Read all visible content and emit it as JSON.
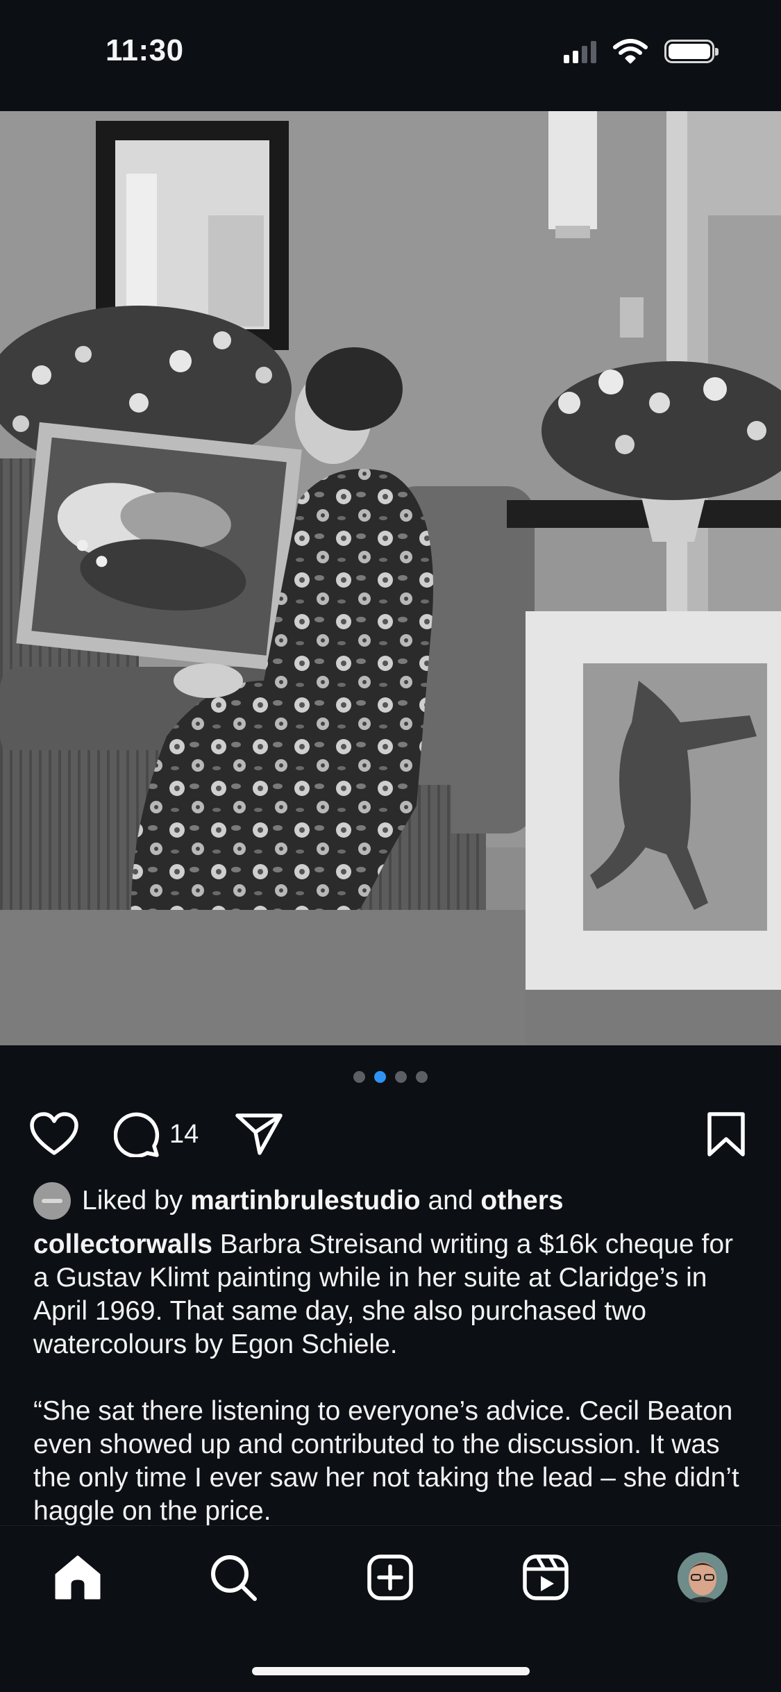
{
  "status_bar": {
    "time": "11:30",
    "signal_icon": "cellular-signal-icon",
    "wifi_icon": "wifi-icon",
    "battery_icon": "battery-icon"
  },
  "post": {
    "image_description_icon": "photo",
    "carousel": {
      "total": 4,
      "active_index": 1
    },
    "actions": {
      "like_icon": "heart-icon",
      "comment_icon": "comment-bubble-icon",
      "comment_count": "14",
      "share_icon": "paper-plane-icon",
      "save_icon": "bookmark-icon"
    },
    "liked_by": {
      "prefix": "Liked by",
      "user": "martinbrulestudio",
      "conjunction": "and",
      "others": "others"
    },
    "caption": {
      "username": "collectorwalls",
      "paragraph1": " Barbra Streisand writing a $16k cheque for a Gustav Klimt painting while in her suite at Claridge’s in April 1969. That same day, she also purchased two watercolours by Egon Schiele.",
      "paragraph2": "“She sat there listening to everyone’s advice. Cecil Beaton even showed up and contributed to the discussion. It was the only time I ever saw her not taking the lead – she didn’t haggle on the price."
    }
  },
  "tabbar": {
    "items": [
      {
        "name": "home",
        "icon": "home-icon"
      },
      {
        "name": "search",
        "icon": "search-icon"
      },
      {
        "name": "create",
        "icon": "plus-square-icon"
      },
      {
        "name": "reels",
        "icon": "reels-icon"
      },
      {
        "name": "profile",
        "icon": "profile-avatar-icon"
      }
    ]
  }
}
